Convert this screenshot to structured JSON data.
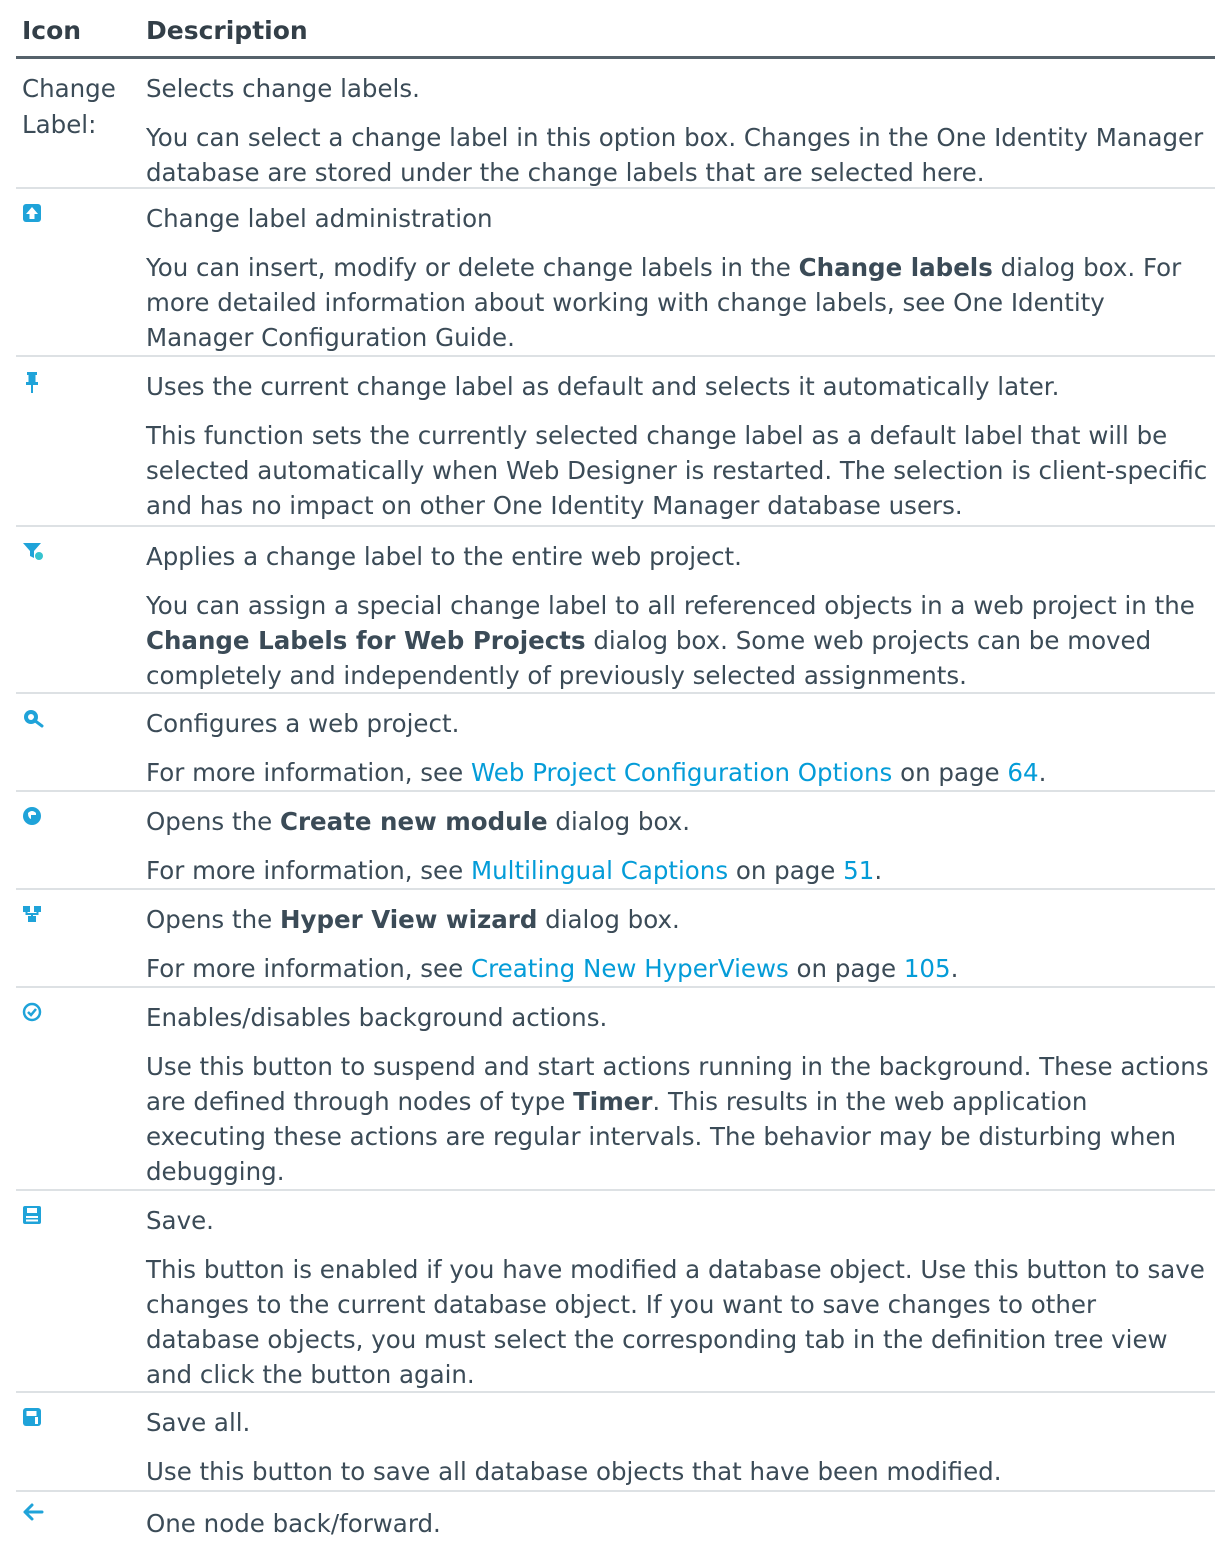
{
  "table": {
    "header": {
      "icon": "Icon",
      "description": "Description"
    },
    "rows": [
      {
        "icon_text": "Change Label:",
        "title": "Selects change labels.",
        "detail": "You can select a change label in this option box. Changes in the One Identity Manager database are stored under the change labels that are selected here."
      },
      {
        "icon": "change-label-administration-icon",
        "title": "Change label administration",
        "detail_pre": "You can insert, modify or delete change labels in the ",
        "detail_bold": "Change labels",
        "detail_post": " dialog box. For more detailed information about working with change labels, see One Identity Manager Configuration Guide."
      },
      {
        "icon": "pin-icon",
        "title": "Uses the current change label as default and selects it automatically later.",
        "detail": "This function sets the currently selected change label as a default label that will be selected automatically when Web Designer is restarted. The selection is client-specific and has no impact on other One Identity Manager database users."
      },
      {
        "icon": "filter-label-icon",
        "title": "Applies a change label to the entire web project.",
        "detail_pre": "You can assign a special change label to all referenced objects in a web project in the ",
        "detail_bold": "Change Labels for Web Projects",
        "detail_post": " dialog box. Some web projects can be moved completely and independently of previously selected assignments."
      },
      {
        "icon": "configure-icon",
        "title": "Configures a web project.",
        "more_pre": "For more information, see ",
        "link": "Web Project Configuration Options",
        "on_page": " on page ",
        "page": "64",
        "period": "."
      },
      {
        "icon": "new-module-icon",
        "title_pre": "Opens the ",
        "title_bold": "Create new module",
        "title_post": "  dialog box.",
        "more_pre": "For more information, see ",
        "link": "Multilingual Captions",
        "on_page": " on page ",
        "page": "51",
        "period": "."
      },
      {
        "icon": "hyperview-wizard-icon",
        "title_pre": "Opens the ",
        "title_bold": "Hyper View wizard",
        "title_post": " dialog box.",
        "more_pre": "For more information, see ",
        "link": "Creating New HyperViews",
        "on_page": " on page ",
        "page": "105",
        "period": "."
      },
      {
        "icon": "background-actions-icon",
        "title": "Enables/disables background actions.",
        "detail_pre": "Use this button to suspend and start actions running in the background. These actions are defined through nodes of type ",
        "detail_bold": "Timer",
        "detail_post": ". This results in the web application executing these actions are regular intervals. The behavior may be disturbing when debugging."
      },
      {
        "icon": "save-icon",
        "title": "Save.",
        "detail": "This button is enabled if you have modified a database object. Use this button to save changes to the current database object. If you want to save changes to other database objects, you must select the corresponding tab in the definition tree view and click the button again."
      },
      {
        "icon": "save-all-icon",
        "title": "Save all.",
        "detail": "Use this button to save all database objects that have been modified."
      },
      {
        "icon": "arrow-left-icon",
        "title": "One node back/forward."
      }
    ]
  },
  "colors": {
    "text": "#3b4b57",
    "link": "#049cd8",
    "icon": "#1fa3d9",
    "header_rule": "#56626b",
    "row_rule": "#dde1e4"
  }
}
